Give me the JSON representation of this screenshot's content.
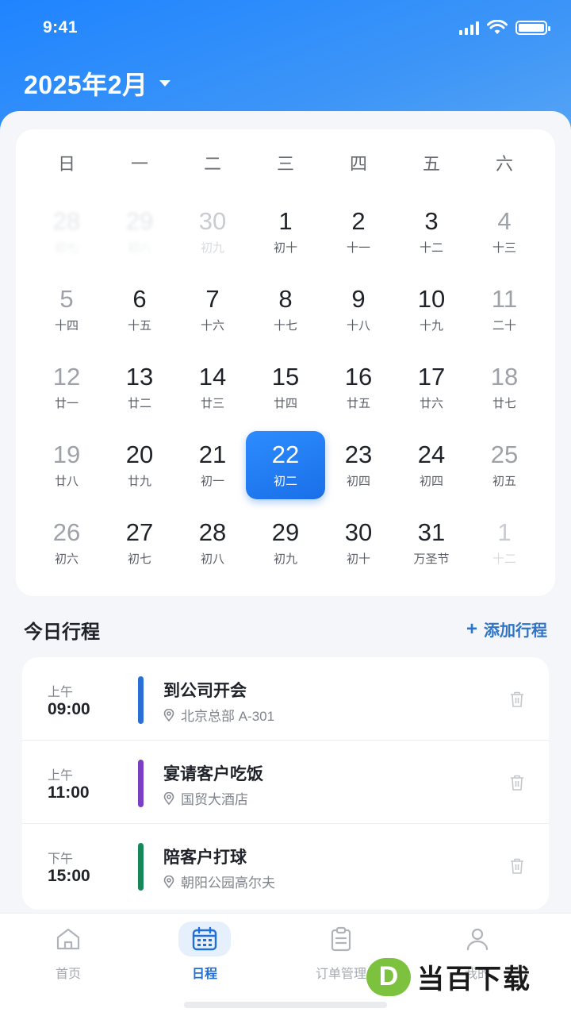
{
  "status": {
    "time": "9:41"
  },
  "header": {
    "month_title": "2025年2月"
  },
  "calendar": {
    "weekdays": [
      "日",
      "一",
      "二",
      "三",
      "四",
      "五",
      "六"
    ],
    "selected_day": "22",
    "weeks": [
      [
        {
          "num": "28",
          "lunar": "初七",
          "state": "faint"
        },
        {
          "num": "29",
          "lunar": "初八",
          "state": "faint"
        },
        {
          "num": "30",
          "lunar": "初九",
          "state": "other"
        },
        {
          "num": "1",
          "lunar": "初十",
          "state": "normal"
        },
        {
          "num": "2",
          "lunar": "十一",
          "state": "normal"
        },
        {
          "num": "3",
          "lunar": "十二",
          "state": "normal"
        },
        {
          "num": "4",
          "lunar": "十三",
          "state": "weekend"
        }
      ],
      [
        {
          "num": "5",
          "lunar": "十四",
          "state": "weekend"
        },
        {
          "num": "6",
          "lunar": "十五",
          "state": "normal"
        },
        {
          "num": "7",
          "lunar": "十六",
          "state": "normal"
        },
        {
          "num": "8",
          "lunar": "十七",
          "state": "normal"
        },
        {
          "num": "9",
          "lunar": "十八",
          "state": "normal"
        },
        {
          "num": "10",
          "lunar": "十九",
          "state": "normal"
        },
        {
          "num": "11",
          "lunar": "二十",
          "state": "weekend"
        }
      ],
      [
        {
          "num": "12",
          "lunar": "廿一",
          "state": "weekend"
        },
        {
          "num": "13",
          "lunar": "廿二",
          "state": "normal"
        },
        {
          "num": "14",
          "lunar": "廿三",
          "state": "normal"
        },
        {
          "num": "15",
          "lunar": "廿四",
          "state": "normal"
        },
        {
          "num": "16",
          "lunar": "廿五",
          "state": "normal"
        },
        {
          "num": "17",
          "lunar": "廿六",
          "state": "normal"
        },
        {
          "num": "18",
          "lunar": "廿七",
          "state": "weekend"
        }
      ],
      [
        {
          "num": "19",
          "lunar": "廿八",
          "state": "weekend"
        },
        {
          "num": "20",
          "lunar": "廿九",
          "state": "normal"
        },
        {
          "num": "21",
          "lunar": "初一",
          "state": "normal"
        },
        {
          "num": "22",
          "lunar": "初二",
          "state": "selected"
        },
        {
          "num": "23",
          "lunar": "初四",
          "state": "normal"
        },
        {
          "num": "24",
          "lunar": "初四",
          "state": "normal"
        },
        {
          "num": "25",
          "lunar": "初五",
          "state": "weekend"
        }
      ],
      [
        {
          "num": "26",
          "lunar": "初六",
          "state": "weekend"
        },
        {
          "num": "27",
          "lunar": "初七",
          "state": "normal"
        },
        {
          "num": "28",
          "lunar": "初八",
          "state": "normal"
        },
        {
          "num": "29",
          "lunar": "初九",
          "state": "normal"
        },
        {
          "num": "30",
          "lunar": "初十",
          "state": "normal"
        },
        {
          "num": "31",
          "lunar": "万圣节",
          "state": "normal"
        },
        {
          "num": "1",
          "lunar": "十二",
          "state": "other"
        }
      ]
    ]
  },
  "schedule": {
    "title": "今日行程",
    "add_label": "添加行程",
    "events": [
      {
        "period": "上午",
        "time": "09:00",
        "title": "到公司开会",
        "location": "北京总部 A-301",
        "color": "#2a6fd6"
      },
      {
        "period": "上午",
        "time": "11:00",
        "title": "宴请客户吃饭",
        "location": "国贸大酒店",
        "color": "#7b3fc4"
      },
      {
        "period": "下午",
        "time": "15:00",
        "title": "陪客户打球",
        "location": "朝阳公园高尔夫",
        "color": "#17875a"
      }
    ]
  },
  "tabs": [
    {
      "label": "首页",
      "icon": "home-icon",
      "active": false
    },
    {
      "label": "日程",
      "icon": "calendar-icon",
      "active": true
    },
    {
      "label": "订单管理",
      "icon": "clipboard-icon",
      "active": false
    },
    {
      "label": "我的",
      "icon": "user-icon",
      "active": false
    }
  ],
  "watermark": {
    "logo_letter": "D",
    "text": "当百下载"
  },
  "colors": {
    "primary": "#1f84ff",
    "accent": "#2e74c9"
  }
}
